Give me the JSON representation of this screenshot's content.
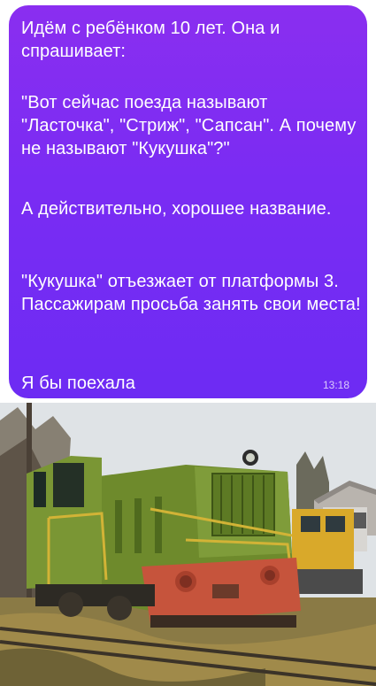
{
  "message": {
    "paragraph_1": "Идём с ребёнком 10 лет. Она и спрашивает:",
    "paragraph_2": "\"Вот сейчас поезда называют \"Ласточка\", \"Стриж\", \"Сапсан\". А почему не называют \"Кукушка\"?\"",
    "paragraph_3": "А действительно, хорошее название.",
    "paragraph_4": "\"Кукушка\" отъезжает от платформы 3. Пассажирам просьба занять свои места!",
    "paragraph_5": "Я бы поехала",
    "time": "13:18",
    "bubble_color": "#7a2cf3"
  },
  "photo": {
    "subject": "old-green-locomotive",
    "colors": {
      "sky": "#dfe3e6",
      "body_green": "#6e8a2c",
      "buffer_red": "#c6543c",
      "ground": "#8a7a45"
    }
  }
}
